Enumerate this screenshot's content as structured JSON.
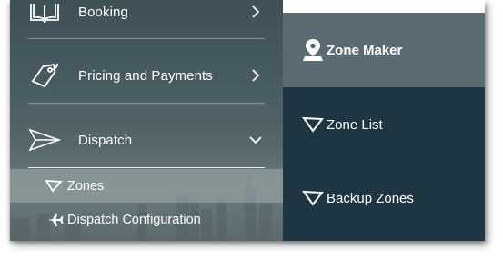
{
  "sidebar": {
    "items": [
      {
        "label": "Booking",
        "icon": "book-icon"
      },
      {
        "label": "Pricing and Payments",
        "icon": "price-tag-icon"
      },
      {
        "label": "Dispatch",
        "icon": "paper-plane-icon"
      }
    ],
    "submenu": [
      {
        "label": "Zones",
        "icon": "zone-polygon-icon"
      },
      {
        "label": "Dispatch Configuration",
        "icon": "airplane-icon"
      }
    ]
  },
  "zones_panel": {
    "items": [
      {
        "label": "Zone Maker",
        "icon": "map-pin-icon",
        "active": true
      },
      {
        "label": "Zone List",
        "icon": "zone-polygon-icon"
      },
      {
        "label": "Backup Zones",
        "icon": "zone-polygon-icon"
      }
    ]
  },
  "colors": {
    "panel_bg": "#1f3542",
    "active_item_bg": "#5b6b73",
    "text": "#ffffff"
  }
}
